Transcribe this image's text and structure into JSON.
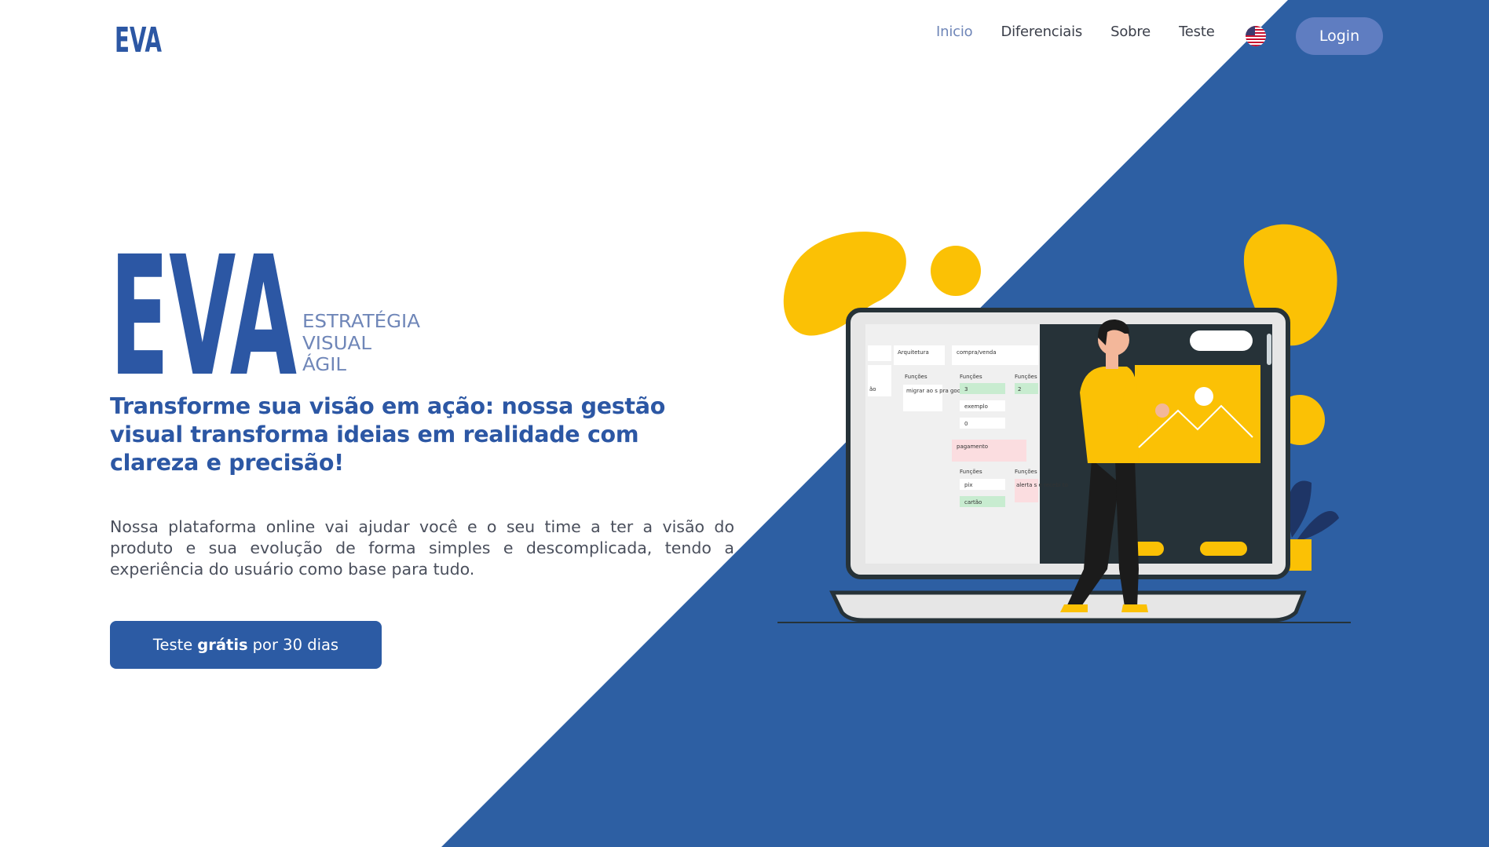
{
  "brand": {
    "logo_text": "EVA",
    "logo_subtitle": [
      "ESTRATÉGIA",
      "VISUAL",
      "ÁGIL"
    ]
  },
  "nav": {
    "items": [
      {
        "label": "Inicio",
        "active": true
      },
      {
        "label": "Diferenciais",
        "active": false
      },
      {
        "label": "Sobre",
        "active": false
      },
      {
        "label": "Teste",
        "active": false
      }
    ],
    "language_flag": "us-flag-icon",
    "login_label": "Login"
  },
  "hero": {
    "tagline": "Transforme sua visão em ação: nossa gestão visual transforma ideias em realidade com clareza e precisão!",
    "description": "Nossa plataforma online vai ajudar você e o seu time a ter a visão do produto e sua evolução de forma simples e descomplicada, tendo a experiência do usuário como base para tudo.",
    "cta": {
      "prefix": "Teste",
      "bold": "grátis",
      "suffix": "por 30 dias"
    }
  },
  "board_preview": {
    "columns": [
      "Arquitetura",
      "compra/venda"
    ],
    "section_label": "Funções",
    "cards": [
      "migrar ao s pra goog le",
      "3",
      "exemplo",
      "0",
      "2",
      "pix",
      "cartão",
      "alerta s e recebi to"
    ],
    "highlight": "pagamento",
    "partial": "ão"
  },
  "colors": {
    "brand_blue": "#2c57a4",
    "diagonal_blue": "#2d5fa3",
    "login_blue": "#5f7dc1",
    "accent_yellow": "#fbc105",
    "dark_screen": "#263238"
  }
}
